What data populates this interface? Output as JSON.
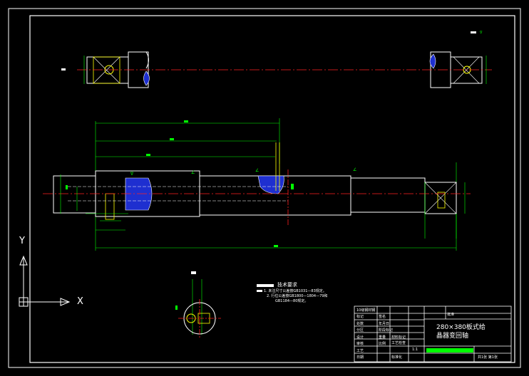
{
  "drawing": {
    "tech_title": "技术要求",
    "tech_req_1": "1. 未注尺寸公差按GB1031—83规定。",
    "tech_req_2": "2. 行位公差按GB1800—1804—79和",
    "tech_req_3": "GB1184—80规定。"
  },
  "title_block": {
    "company": "10级钢材钢",
    "drawing_title_1": "280×380板式给",
    "drawing_title_2": "晶器变回轴",
    "scale": "1:1",
    "sheet": "共1张 第1张",
    "row_labels": [
      "标记",
      "处数",
      "分区",
      "设计",
      "审核",
      "工艺",
      "日期"
    ],
    "col_labels": [
      "签名",
      "年月日",
      "阶段标记",
      "重量",
      "比例"
    ],
    "material_label": "材料标记",
    "process": "工艺检查",
    "std": "标准化",
    "approve": "批准"
  },
  "ucs": {
    "x_label": "X",
    "y_label": "Y"
  },
  "colors": {
    "outline": "#ffffff",
    "dimension": "#00ff00",
    "centerline": "#ff2020",
    "hatch": "#1e2fd0",
    "highlight": "#ffff00"
  }
}
